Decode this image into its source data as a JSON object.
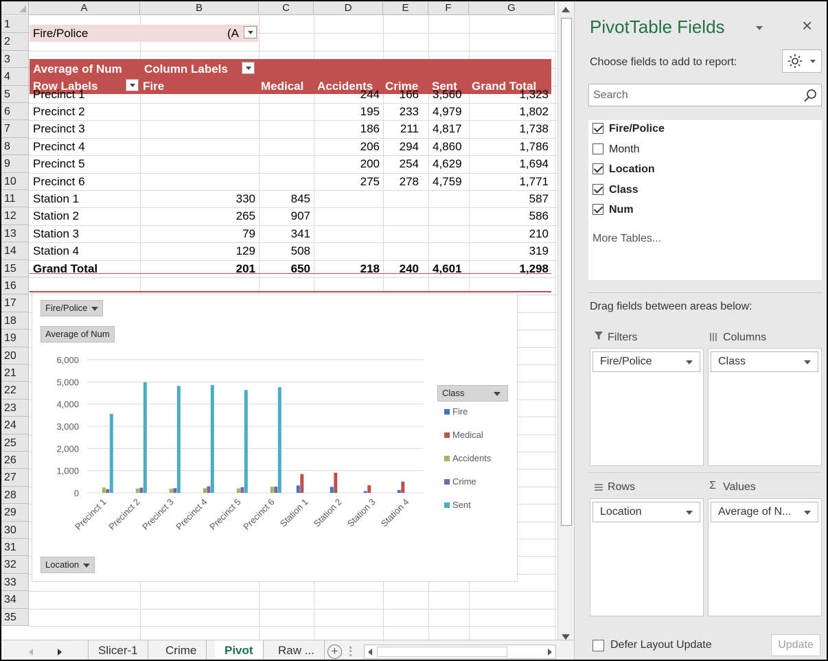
{
  "sheet": {
    "columns": [
      "A",
      "B",
      "C",
      "D",
      "E",
      "F",
      "G"
    ],
    "rows": [
      "1",
      "2",
      "3",
      "4",
      "5",
      "6",
      "7",
      "8",
      "9",
      "10",
      "11",
      "12",
      "13",
      "14",
      "15",
      "16",
      "17",
      "18",
      "19",
      "20",
      "21",
      "22",
      "23",
      "24",
      "25",
      "26",
      "27",
      "28",
      "29",
      "30",
      "31",
      "32",
      "33",
      "34",
      "35"
    ],
    "filter_label": "Fire/Police",
    "filter_value": "(A",
    "pivot_value_label": "Average of Num",
    "column_labels": "Column Labels",
    "row_labels": "Row Labels",
    "col_headers": [
      "Fire",
      "Medical",
      "Accidents",
      "Crime",
      "Sent",
      "Grand Total"
    ],
    "data_rows": [
      {
        "label": "Precinct 1",
        "fire": "",
        "medical": "",
        "accidents": "244",
        "crime": "166",
        "sent": "3,560",
        "total": "1,323"
      },
      {
        "label": "Precinct 2",
        "fire": "",
        "medical": "",
        "accidents": "195",
        "crime": "233",
        "sent": "4,979",
        "total": "1,802"
      },
      {
        "label": "Precinct 3",
        "fire": "",
        "medical": "",
        "accidents": "186",
        "crime": "211",
        "sent": "4,817",
        "total": "1,738"
      },
      {
        "label": "Precinct 4",
        "fire": "",
        "medical": "",
        "accidents": "206",
        "crime": "294",
        "sent": "4,860",
        "total": "1,786"
      },
      {
        "label": "Precinct 5",
        "fire": "",
        "medical": "",
        "accidents": "200",
        "crime": "254",
        "sent": "4,629",
        "total": "1,694"
      },
      {
        "label": "Precinct 6",
        "fire": "",
        "medical": "",
        "accidents": "275",
        "crime": "278",
        "sent": "4,759",
        "total": "1,771"
      },
      {
        "label": "Station 1",
        "fire": "330",
        "medical": "845",
        "accidents": "",
        "crime": "",
        "sent": "",
        "total": "587"
      },
      {
        "label": "Station 2",
        "fire": "265",
        "medical": "907",
        "accidents": "",
        "crime": "",
        "sent": "",
        "total": "586"
      },
      {
        "label": "Station 3",
        "fire": "79",
        "medical": "341",
        "accidents": "",
        "crime": "",
        "sent": "",
        "total": "210"
      },
      {
        "label": "Station 4",
        "fire": "129",
        "medical": "508",
        "accidents": "",
        "crime": "",
        "sent": "",
        "total": "319"
      }
    ],
    "grand_total": {
      "label": "Grand Total",
      "fire": "201",
      "medical": "650",
      "accidents": "218",
      "crime": "240",
      "sent": "4,601",
      "total": "1,298"
    }
  },
  "chart_buttons": {
    "filter": "Fire/Police",
    "values": "Average of Num",
    "axis": "Location",
    "legend": "Class"
  },
  "chart_data": {
    "type": "bar",
    "categories": [
      "Precinct 1",
      "Precinct 2",
      "Precinct 3",
      "Precinct 4",
      "Precinct 5",
      "Precinct 6",
      "Station 1",
      "Station 2",
      "Station 3",
      "Station 4"
    ],
    "series": [
      {
        "name": "Fire",
        "color": "#4472c4",
        "values": [
          null,
          null,
          null,
          null,
          null,
          null,
          330,
          265,
          79,
          129
        ]
      },
      {
        "name": "Medical",
        "color": "#c0504d",
        "values": [
          null,
          null,
          null,
          null,
          null,
          null,
          845,
          907,
          341,
          508
        ]
      },
      {
        "name": "Accidents",
        "color": "#9bbb59",
        "values": [
          244,
          195,
          186,
          206,
          200,
          275,
          null,
          null,
          null,
          null
        ]
      },
      {
        "name": "Crime",
        "color": "#8064a2",
        "values": [
          166,
          233,
          211,
          294,
          254,
          278,
          null,
          null,
          null,
          null
        ]
      },
      {
        "name": "Sent",
        "color": "#4bacc6",
        "values": [
          3560,
          4979,
          4817,
          4860,
          4629,
          4759,
          null,
          null,
          null,
          null
        ]
      }
    ],
    "yticks": [
      "0",
      "1,000",
      "2,000",
      "3,000",
      "4,000",
      "5,000",
      "6,000"
    ],
    "ylim": [
      0,
      6000
    ],
    "grid": true,
    "legend_position": "right"
  },
  "tabs": {
    "items": [
      "Slicer-1",
      "Crime",
      "Pivot",
      "Raw ..."
    ],
    "active": "Pivot",
    "add": "+"
  },
  "pane": {
    "title": "PivotTable Fields",
    "close": "×",
    "choose_label": "Choose fields to add to report:",
    "search_placeholder": "Search",
    "fields": [
      {
        "name": "Fire/Police",
        "checked": true
      },
      {
        "name": "Month",
        "checked": false
      },
      {
        "name": "Location",
        "checked": true
      },
      {
        "name": "Class",
        "checked": true
      },
      {
        "name": "Num",
        "checked": true
      }
    ],
    "more_tables": "More Tables...",
    "drag_label": "Drag fields between areas below:",
    "filters_title": "Filters",
    "columns_title": "Columns",
    "rows_title": "Rows",
    "values_title": "Values",
    "filters_item": "Fire/Police",
    "columns_item": "Class",
    "rows_item": "Location",
    "values_item": "Average of N...",
    "defer_label": "Defer Layout Update",
    "update_label": "Update",
    "accent": "#217346"
  }
}
